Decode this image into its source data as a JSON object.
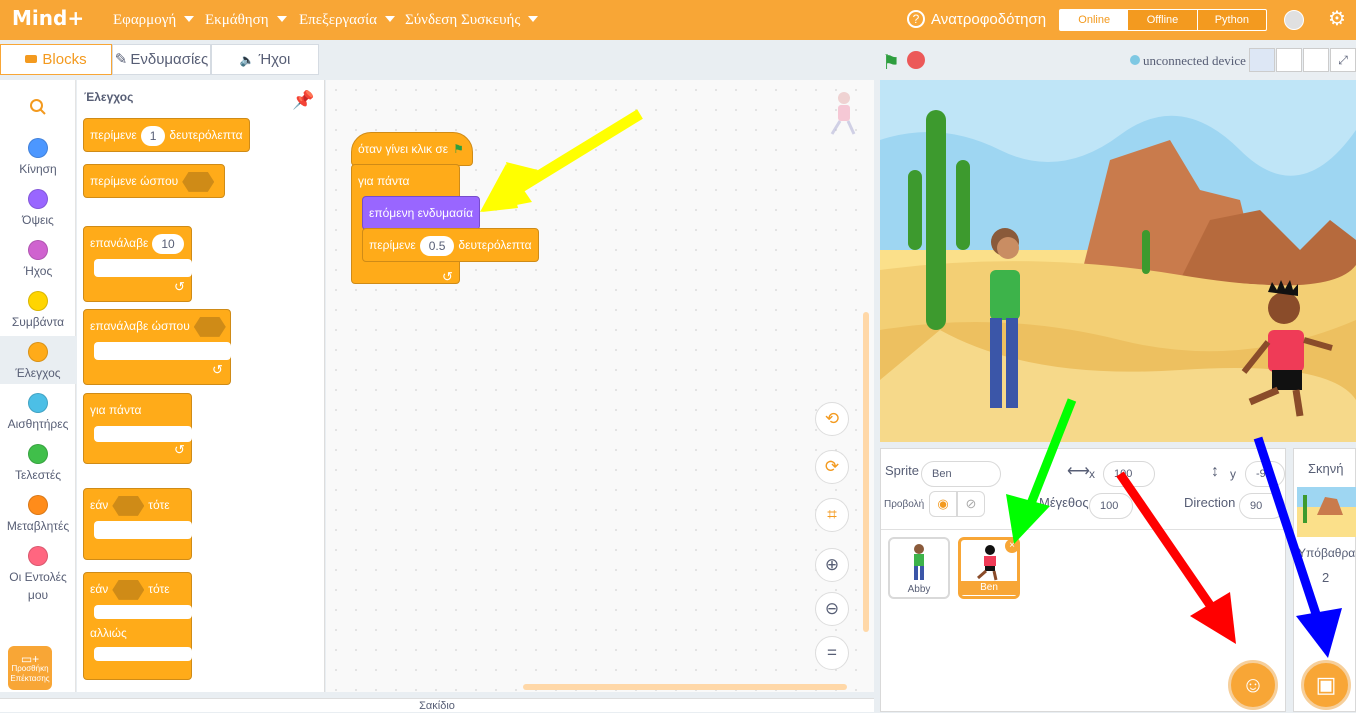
{
  "menubar": {
    "logo": "Mind+",
    "items": [
      "Εφαρμογή",
      "Εκμάθηση",
      "Επεξεργασία",
      "Σύνδεση Συσκευής"
    ],
    "feedback": "Ανατροφοδότηση",
    "modes": [
      "Online",
      "Offline",
      "Python"
    ]
  },
  "tabs": [
    "Blocks",
    "Ενδυμασίες",
    "Ήχοι"
  ],
  "categories": [
    {
      "label": "Κίνηση",
      "color": "#4c97ff"
    },
    {
      "label": "Όψεις",
      "color": "#9966ff"
    },
    {
      "label": "Ήχος",
      "color": "#cf63cf"
    },
    {
      "label": "Συμβάντα",
      "color": "#ffd500"
    },
    {
      "label": "Έλεγχος",
      "color": "#ffab19"
    },
    {
      "label": "Αισθητήρες",
      "color": "#4cbfe6"
    },
    {
      "label": "Τελεστές",
      "color": "#40bf4a"
    },
    {
      "label": "Μεταβλητές",
      "color": "#ff8c1a"
    },
    {
      "label": "Οι Εντολές μου",
      "color": "#ff6680"
    }
  ],
  "add_extension": "Προσθήκη Επέκτασης",
  "palette": {
    "title": "Έλεγχος",
    "wait": "περίμενε",
    "wait_val": "1",
    "seconds": "δευτερόλεπτα",
    "wait_until": "περίμενε ώσπου",
    "repeat": "επανάλαβε",
    "repeat_val": "10",
    "repeat_until": "επανάλαβε ώσπου",
    "forever": "για πάντα",
    "if": "εάν",
    "then": "τότε",
    "else": "αλλιώς"
  },
  "script": {
    "hat": "όταν γίνει κλικ σε",
    "forever": "για πάντα",
    "next_costume": "επόμενη ενδυμασία",
    "wait": "περίμενε",
    "wait_val": "0.5",
    "seconds": "δευτερόλεπτα"
  },
  "stage_header": {
    "device": "unconnected device"
  },
  "sprite_info": {
    "sprite_label": "Sprite",
    "sprite_name": "Ben",
    "x_label": "x",
    "x_val": "100",
    "y_label": "y",
    "y_val": "-9",
    "show_label": "Προβολή",
    "size_label": "Μέγεθος",
    "size_val": "100",
    "direction_label": "Direction",
    "direction_val": "90"
  },
  "sprites": [
    {
      "name": "Abby"
    },
    {
      "name": "Ben"
    }
  ],
  "scene": {
    "label": "Σκηνή",
    "backdrops_label": "Υπόβαθρα",
    "backdrops_count": "2"
  },
  "backpack": "Σακίδιο",
  "colors": {
    "accent": "#f8a636",
    "control": "#ffab19",
    "looks": "#9966ff"
  }
}
